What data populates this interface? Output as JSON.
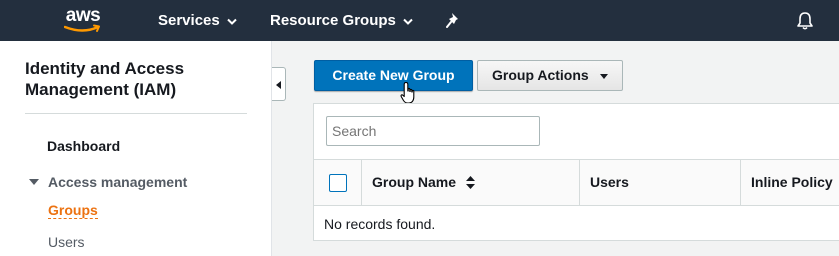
{
  "topbar": {
    "logo_text": "aws",
    "nav": {
      "services": "Services",
      "resource_groups": "Resource Groups"
    },
    "icons": [
      "chevron-down-icon",
      "pin-icon",
      "bell-icon"
    ]
  },
  "sidebar": {
    "title": "Identity and Access Management (IAM)",
    "dashboard": "Dashboard",
    "access_management": "Access management",
    "items": [
      {
        "label": "Groups",
        "active": true
      },
      {
        "label": "Users",
        "active": false
      }
    ]
  },
  "toolbar": {
    "create_label": "Create New Group",
    "actions_label": "Group Actions"
  },
  "search": {
    "placeholder": "Search"
  },
  "table": {
    "columns": [
      "Group Name",
      "Users",
      "Inline Policy"
    ],
    "empty_message": "No records found."
  },
  "colors": {
    "topbar": "#232f3e",
    "primary_button": "#0073bb",
    "active_link": "#ec7211"
  }
}
